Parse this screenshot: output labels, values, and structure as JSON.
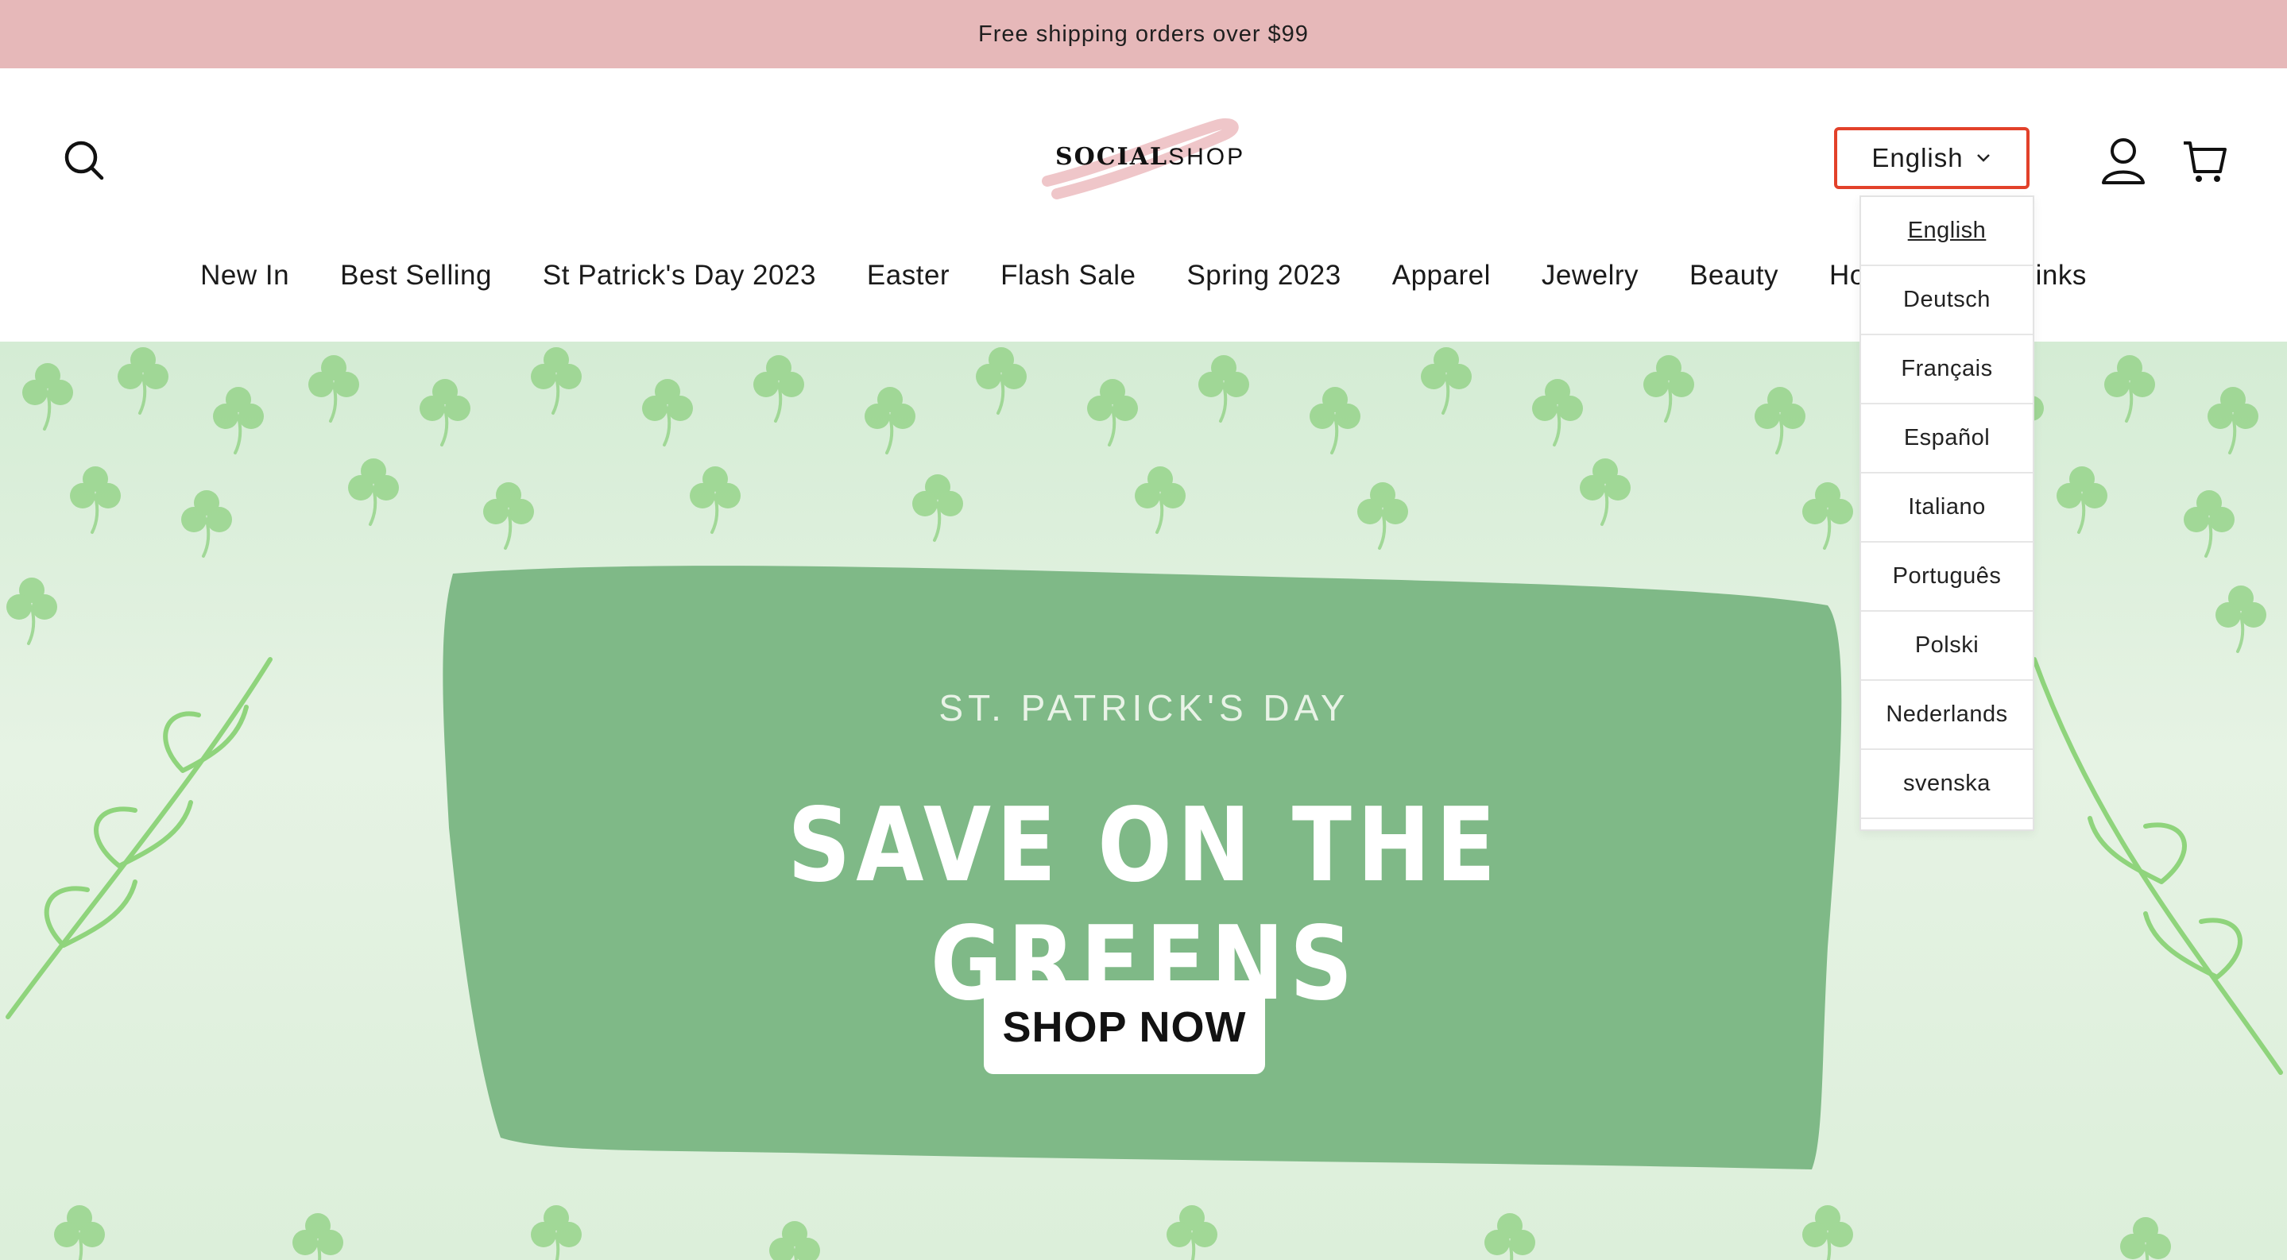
{
  "announcement": {
    "text": "Free shipping orders over $99"
  },
  "header": {
    "logo": {
      "bold": "SOCIAL",
      "thin": "SHOP"
    },
    "language_button": {
      "label": "English"
    }
  },
  "nav": {
    "items": [
      {
        "label": "New In"
      },
      {
        "label": "Best Selling"
      },
      {
        "label": "St Patrick's Day 2023"
      },
      {
        "label": "Easter"
      },
      {
        "label": "Flash Sale"
      },
      {
        "label": "Spring 2023"
      },
      {
        "label": "Apparel"
      },
      {
        "label": "Jewelry"
      },
      {
        "label": "Beauty"
      },
      {
        "label": "Home"
      },
      {
        "label": "More links"
      }
    ]
  },
  "language_menu": {
    "options": [
      {
        "label": "English"
      },
      {
        "label": "Deutsch"
      },
      {
        "label": "Français"
      },
      {
        "label": "Español"
      },
      {
        "label": "Italiano"
      },
      {
        "label": "Português"
      },
      {
        "label": "Polski"
      },
      {
        "label": "Nederlands"
      },
      {
        "label": "svenska"
      }
    ]
  },
  "hero": {
    "eyebrow": "ST. PATRICK'S DAY",
    "title": "SAVE ON THE GREENS",
    "cta": "SHOP NOW"
  },
  "colors": {
    "announcement_bg": "#e6b8b9",
    "language_button_border": "#e2412a",
    "hero_panel": "#7fb987",
    "clover": "#9ad58f"
  }
}
